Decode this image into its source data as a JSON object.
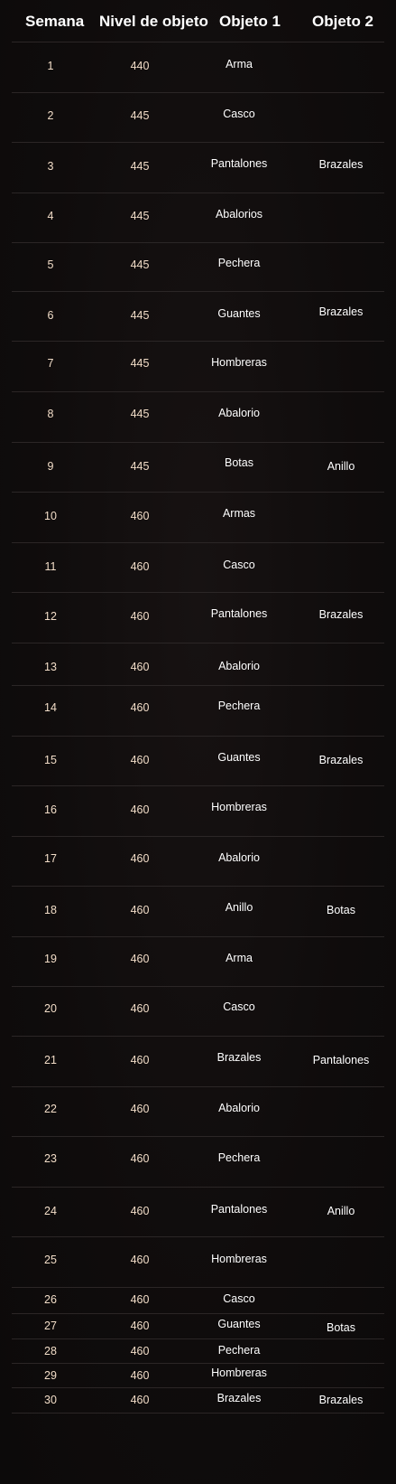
{
  "table": {
    "headers": {
      "week": "Semana",
      "level": "Nivel de objeto",
      "item1": "Objeto 1",
      "item2": "Objeto 2"
    },
    "rows": [
      {
        "week": "1",
        "level": "440",
        "item1": "Arma",
        "item2": ""
      },
      {
        "week": "2",
        "level": "445",
        "item1": "Casco",
        "item2": ""
      },
      {
        "week": "3",
        "level": "445",
        "item1": "Pantalones",
        "item2": "Brazales"
      },
      {
        "week": "4",
        "level": "445",
        "item1": "Abalorios",
        "item2": ""
      },
      {
        "week": "5",
        "level": "445",
        "item1": "Pechera",
        "item2": ""
      },
      {
        "week": "6",
        "level": "445",
        "item1": "Guantes",
        "item2": "Brazales"
      },
      {
        "week": "7",
        "level": "445",
        "item1": "Hombreras",
        "item2": ""
      },
      {
        "week": "8",
        "level": "445",
        "item1": "Abalorio",
        "item2": ""
      },
      {
        "week": "9",
        "level": "445",
        "item1": "Botas",
        "item2": "Anillo"
      },
      {
        "week": "10",
        "level": "460",
        "item1": "Armas",
        "item2": ""
      },
      {
        "week": "11",
        "level": "460",
        "item1": "Casco",
        "item2": ""
      },
      {
        "week": "12",
        "level": "460",
        "item1": "Pantalones",
        "item2": "Brazales"
      },
      {
        "week": "13",
        "level": "460",
        "item1": "Abalorio",
        "item2": ""
      },
      {
        "week": "14",
        "level": "460",
        "item1": "Pechera",
        "item2": ""
      },
      {
        "week": "15",
        "level": "460",
        "item1": "Guantes",
        "item2": "Brazales"
      },
      {
        "week": "16",
        "level": "460",
        "item1": "Hombreras",
        "item2": ""
      },
      {
        "week": "17",
        "level": "460",
        "item1": "Abalorio",
        "item2": ""
      },
      {
        "week": "18",
        "level": "460",
        "item1": "Anillo",
        "item2": "Botas"
      },
      {
        "week": "19",
        "level": "460",
        "item1": "Arma",
        "item2": ""
      },
      {
        "week": "20",
        "level": "460",
        "item1": "Casco",
        "item2": ""
      },
      {
        "week": "21",
        "level": "460",
        "item1": "Brazales",
        "item2": "Pantalones"
      },
      {
        "week": "22",
        "level": "460",
        "item1": "Abalorio",
        "item2": ""
      },
      {
        "week": "23",
        "level": "460",
        "item1": "Pechera",
        "item2": ""
      },
      {
        "week": "24",
        "level": "460",
        "item1": "Pantalones",
        "item2": "Anillo"
      },
      {
        "week": "25",
        "level": "460",
        "item1": "Hombreras",
        "item2": ""
      },
      {
        "week": "26",
        "level": "460",
        "item1": "Casco",
        "item2": ""
      },
      {
        "week": "27",
        "level": "460",
        "item1": "Guantes",
        "item2": "Botas"
      },
      {
        "week": "28",
        "level": "460",
        "item1": "Pechera",
        "item2": ""
      },
      {
        "week": "29",
        "level": "460",
        "item1": "Hombreras",
        "item2": ""
      },
      {
        "week": "30",
        "level": "460",
        "item1": "Brazales",
        "item2": "Brazales"
      }
    ]
  }
}
